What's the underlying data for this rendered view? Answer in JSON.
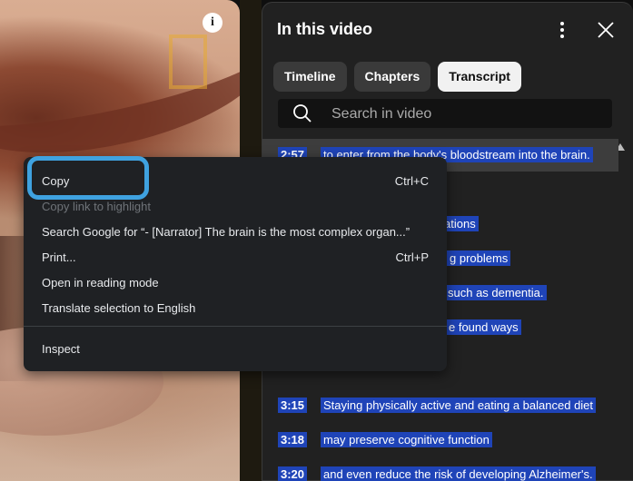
{
  "panel": {
    "title": "In this video",
    "tabs": [
      {
        "label": "Timeline"
      },
      {
        "label": "Chapters"
      },
      {
        "label": "Transcript"
      }
    ],
    "search_placeholder": "Search in video",
    "transcript": [
      {
        "time": "2:57",
        "text": "to enter from the body's bloodstream into the brain."
      },
      {
        "time": "",
        "text": ""
      },
      {
        "time": "",
        "text": "ations"
      },
      {
        "time": "",
        "text": "g problems"
      },
      {
        "time": "",
        "text": "such as dementia."
      },
      {
        "time": "",
        "text": "e found ways"
      },
      {
        "time": "",
        "text": ""
      },
      {
        "time": "3:15",
        "text": "Staying physically active and eating a balanced diet"
      },
      {
        "time": "3:18",
        "text": "may preserve cognitive function"
      },
      {
        "time": "3:20",
        "text": "and even reduce the risk of developing Alzheimer's."
      }
    ]
  },
  "context_menu": {
    "items": [
      {
        "label": "Copy",
        "shortcut": "Ctrl+C"
      },
      {
        "label": "Copy link to highlight",
        "shortcut": ""
      },
      {
        "label": "Search Google for “- [Narrator] The brain is the most complex organ...”",
        "shortcut": ""
      },
      {
        "label": "Print...",
        "shortcut": "Ctrl+P"
      },
      {
        "label": "Open in reading mode",
        "shortcut": ""
      },
      {
        "label": "Translate selection to English",
        "shortcut": ""
      },
      {
        "label": "Inspect",
        "shortcut": ""
      }
    ]
  },
  "video": {
    "info_icon": "info-icon",
    "info_glyph": "i"
  },
  "colors": {
    "selection": "#1f44b8",
    "focus_ring": "#3fa2e0",
    "panel_bg": "#212121",
    "menu_bg": "#1f2124"
  }
}
